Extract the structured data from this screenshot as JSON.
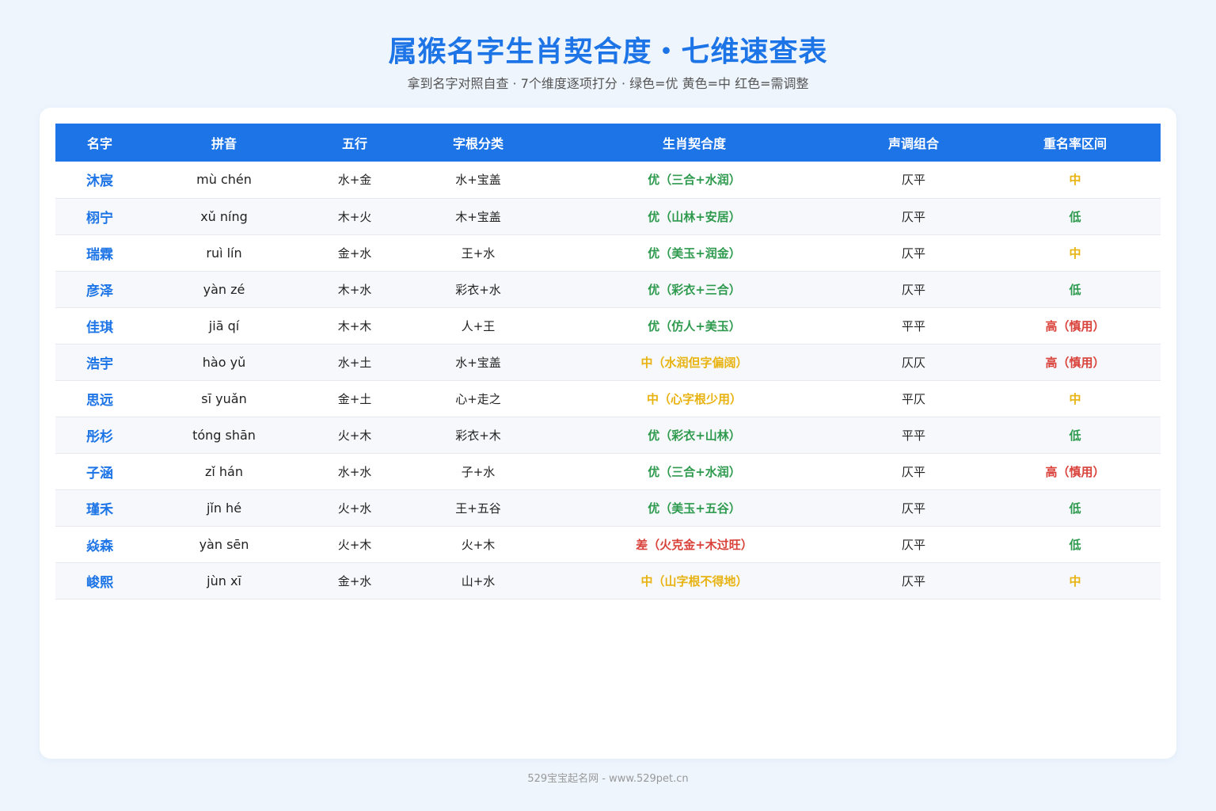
{
  "title": "属猴名字生肖契合度・七维速查表",
  "subtitle": "拿到名字对照自查 · 7个维度逐项打分 · 绿色=优 黄色=中 红色=需调整",
  "colors": {
    "accent": "#1c74e6",
    "good": "#2e9a4e",
    "mid": "#e8b311",
    "bad": "#d9413a"
  },
  "table": {
    "headers": [
      "名字",
      "拼音",
      "五行",
      "字根分类",
      "生肖契合度",
      "声调组合",
      "重名率区间"
    ],
    "rows": [
      {
        "name": "沐宸",
        "pinyin": "mù chén",
        "wuxing": "水+金",
        "zigen": "水+宝盖",
        "fit": "优（三合+水润）",
        "fit_level": "good",
        "tone": "仄平",
        "dup": "中",
        "dup_level": "mid"
      },
      {
        "name": "栩宁",
        "pinyin": "xǔ níng",
        "wuxing": "木+火",
        "zigen": "木+宝盖",
        "fit": "优（山林+安居）",
        "fit_level": "good",
        "tone": "仄平",
        "dup": "低",
        "dup_level": "good"
      },
      {
        "name": "瑞霖",
        "pinyin": "ruì lín",
        "wuxing": "金+水",
        "zigen": "王+水",
        "fit": "优（美玉+润金）",
        "fit_level": "good",
        "tone": "仄平",
        "dup": "中",
        "dup_level": "mid"
      },
      {
        "name": "彦泽",
        "pinyin": "yàn zé",
        "wuxing": "木+水",
        "zigen": "彩衣+水",
        "fit": "优（彩衣+三合）",
        "fit_level": "good",
        "tone": "仄平",
        "dup": "低",
        "dup_level": "good"
      },
      {
        "name": "佳琪",
        "pinyin": "jiā qí",
        "wuxing": "木+木",
        "zigen": "人+王",
        "fit": "优（仿人+美玉）",
        "fit_level": "good",
        "tone": "平平",
        "dup": "高（慎用）",
        "dup_level": "bad"
      },
      {
        "name": "浩宇",
        "pinyin": "hào yǔ",
        "wuxing": "水+土",
        "zigen": "水+宝盖",
        "fit": "中（水润但字偏阔）",
        "fit_level": "mid",
        "tone": "仄仄",
        "dup": "高（慎用）",
        "dup_level": "bad"
      },
      {
        "name": "思远",
        "pinyin": "sī yuǎn",
        "wuxing": "金+土",
        "zigen": "心+走之",
        "fit": "中（心字根少用）",
        "fit_level": "mid",
        "tone": "平仄",
        "dup": "中",
        "dup_level": "mid"
      },
      {
        "name": "彤杉",
        "pinyin": "tóng shān",
        "wuxing": "火+木",
        "zigen": "彩衣+木",
        "fit": "优（彩衣+山林）",
        "fit_level": "good",
        "tone": "平平",
        "dup": "低",
        "dup_level": "good"
      },
      {
        "name": "子涵",
        "pinyin": "zǐ hán",
        "wuxing": "水+水",
        "zigen": "子+水",
        "fit": "优（三合+水润）",
        "fit_level": "good",
        "tone": "仄平",
        "dup": "高（慎用）",
        "dup_level": "bad"
      },
      {
        "name": "瑾禾",
        "pinyin": "jǐn hé",
        "wuxing": "火+水",
        "zigen": "王+五谷",
        "fit": "优（美玉+五谷）",
        "fit_level": "good",
        "tone": "仄平",
        "dup": "低",
        "dup_level": "good"
      },
      {
        "name": "焱森",
        "pinyin": "yàn sēn",
        "wuxing": "火+木",
        "zigen": "火+木",
        "fit": "差（火克金+木过旺）",
        "fit_level": "bad",
        "tone": "仄平",
        "dup": "低",
        "dup_level": "good"
      },
      {
        "name": "峻熙",
        "pinyin": "jùn xī",
        "wuxing": "金+水",
        "zigen": "山+水",
        "fit": "中（山字根不得地）",
        "fit_level": "mid",
        "tone": "仄平",
        "dup": "中",
        "dup_level": "mid"
      }
    ]
  },
  "footer": "529宝宝起名网 - www.529pet.cn"
}
